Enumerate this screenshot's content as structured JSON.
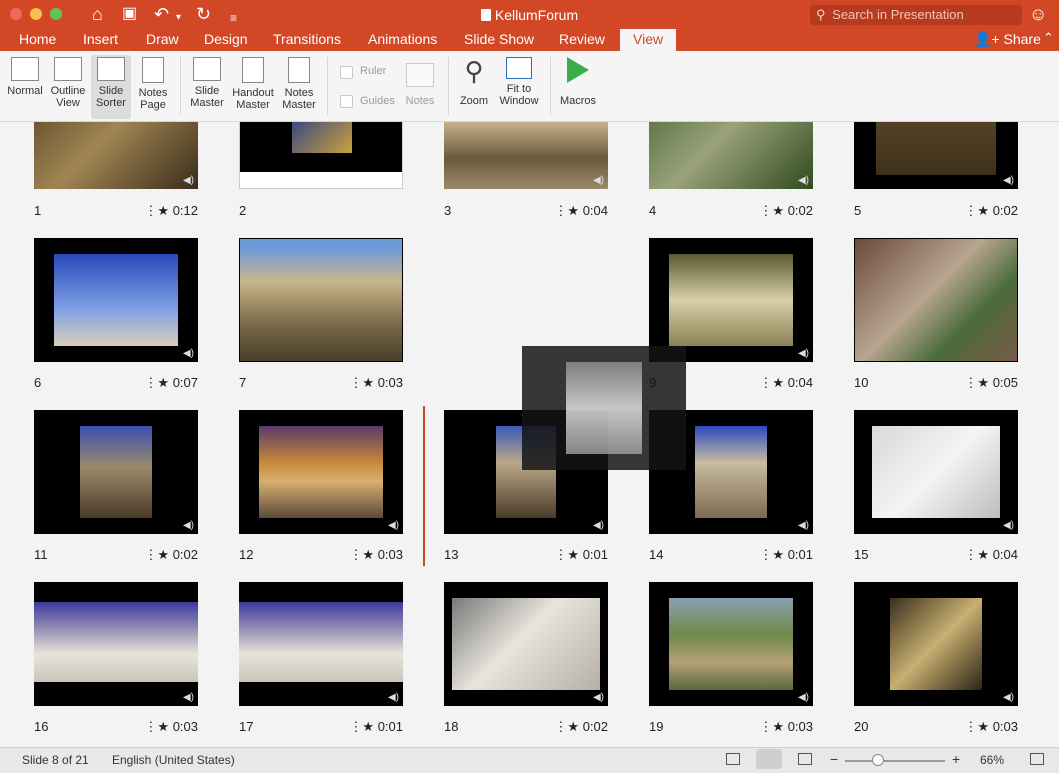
{
  "window": {
    "title": "KellumForum"
  },
  "search": {
    "placeholder": "Search in Presentation"
  },
  "tabs": [
    {
      "label": "Home"
    },
    {
      "label": "Insert"
    },
    {
      "label": "Draw"
    },
    {
      "label": "Design"
    },
    {
      "label": "Transitions"
    },
    {
      "label": "Animations"
    },
    {
      "label": "Slide Show"
    },
    {
      "label": "Review"
    },
    {
      "label": "View"
    }
  ],
  "share": {
    "label": "Share"
  },
  "ribbon": {
    "normal": "Normal",
    "outline1": "Outline",
    "outline2": "View",
    "sorter1": "Slide",
    "sorter2": "Sorter",
    "notespage1": "Notes",
    "notespage2": "Page",
    "slidemaster1": "Slide",
    "slidemaster2": "Master",
    "handout1": "Handout",
    "handout2": "Master",
    "notesmaster1": "Notes",
    "notesmaster2": "Master",
    "ruler": "Ruler",
    "guides": "Guides",
    "notes": "Notes",
    "zoom": "Zoom",
    "fit1": "Fit to",
    "fit2": "Window",
    "macros": "Macros"
  },
  "slides": [
    {
      "n": "1",
      "t": "0:12"
    },
    {
      "n": "2",
      "t": ""
    },
    {
      "n": "3",
      "t": "0:04"
    },
    {
      "n": "4",
      "t": "0:02"
    },
    {
      "n": "5",
      "t": "0:02"
    },
    {
      "n": "6",
      "t": "0:07"
    },
    {
      "n": "7",
      "t": "0:03"
    },
    {
      "n": "9",
      "t": "0:04"
    },
    {
      "n": "10",
      "t": "0:05"
    },
    {
      "n": "11",
      "t": "0:02"
    },
    {
      "n": "12",
      "t": "0:03"
    },
    {
      "n": "13",
      "t": "0:01"
    },
    {
      "n": "14",
      "t": "0:01"
    },
    {
      "n": "15",
      "t": "0:04"
    },
    {
      "n": "16",
      "t": "0:03"
    },
    {
      "n": "17",
      "t": "0:01"
    },
    {
      "n": "18",
      "t": "0:02"
    },
    {
      "n": "19",
      "t": "0:03"
    },
    {
      "n": "20",
      "t": "0:03"
    }
  ],
  "status": {
    "slide": "Slide 8 of 21",
    "language": "English (United States)",
    "zoom": "66%"
  },
  "colors": {
    "accent": "#d24726"
  }
}
